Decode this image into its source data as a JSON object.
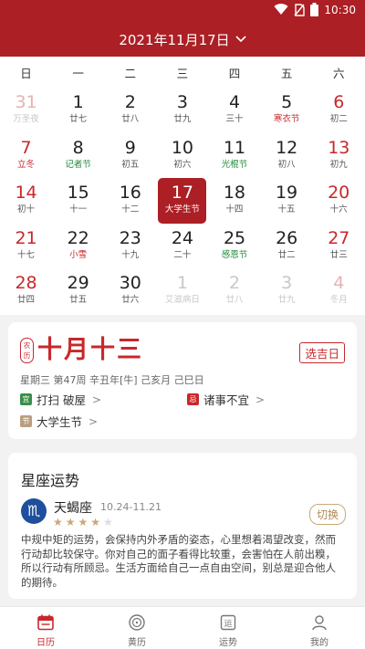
{
  "status": {
    "time": "10:30"
  },
  "header": {
    "month_title": "2021年11月17日"
  },
  "weekdays": [
    "日",
    "一",
    "二",
    "三",
    "四",
    "五",
    "六"
  ],
  "weeks": [
    [
      {
        "num": "31",
        "sub": "万圣夜"
      },
      {
        "num": "1",
        "sub": "廿七"
      },
      {
        "num": "2",
        "sub": "廿八"
      },
      {
        "num": "3",
        "sub": "廿九"
      },
      {
        "num": "4",
        "sub": "三十"
      },
      {
        "num": "5",
        "sub": "寒衣节"
      },
      {
        "num": "6",
        "sub": "初二"
      }
    ],
    [
      {
        "num": "7",
        "sub": "立冬"
      },
      {
        "num": "8",
        "sub": "记者节"
      },
      {
        "num": "9",
        "sub": "初五"
      },
      {
        "num": "10",
        "sub": "初六"
      },
      {
        "num": "11",
        "sub": "光棍节"
      },
      {
        "num": "12",
        "sub": "初八"
      },
      {
        "num": "13",
        "sub": "初九"
      }
    ],
    [
      {
        "num": "14",
        "sub": "初十"
      },
      {
        "num": "15",
        "sub": "十一"
      },
      {
        "num": "16",
        "sub": "十二"
      },
      {
        "num": "17",
        "sub": "大学生节"
      },
      {
        "num": "18",
        "sub": "十四"
      },
      {
        "num": "19",
        "sub": "十五"
      },
      {
        "num": "20",
        "sub": "十六"
      }
    ],
    [
      {
        "num": "21",
        "sub": "十七"
      },
      {
        "num": "22",
        "sub": "小雪"
      },
      {
        "num": "23",
        "sub": "十九"
      },
      {
        "num": "24",
        "sub": "二十"
      },
      {
        "num": "25",
        "sub": "感恩节"
      },
      {
        "num": "26",
        "sub": "廿二"
      },
      {
        "num": "27",
        "sub": "廿三"
      }
    ],
    [
      {
        "num": "28",
        "sub": "廿四"
      },
      {
        "num": "29",
        "sub": "廿五"
      },
      {
        "num": "30",
        "sub": "廿六"
      },
      {
        "num": "1",
        "sub": "艾滋病日"
      },
      {
        "num": "2",
        "sub": "廿八"
      },
      {
        "num": "3",
        "sub": "廿九"
      },
      {
        "num": "4",
        "sub": "冬月"
      }
    ]
  ],
  "almanac": {
    "seal": "农历",
    "lunar_date": "十月十三",
    "pick_day": "选吉日",
    "ganzhi": "星期三 第47周 辛丑年[牛] 己亥月 己巳日",
    "yi_tag": "宜",
    "yi_text": "打扫 破屋",
    "ji_tag": "忌",
    "ji_text": "诸事不宜",
    "fest_tag": "节",
    "fest_text": "大学生节"
  },
  "horoscope": {
    "title": "星座运势",
    "sign": "天蝎座",
    "range": "10.24-11.21",
    "rating": 4,
    "switch": "切换",
    "text": "中规中矩的运势，会保持内外矛盾的姿态，心里想着渴望改变，然而行动却比较保守。你对自己的面子看得比较重，会害怕在人前出糗，所以行动有所顾忌。生活方面给自己一点自由空间，别总是迎合他人的期待。"
  },
  "tabs": [
    {
      "label": "日历",
      "active": true
    },
    {
      "label": "黄历"
    },
    {
      "label": "运势"
    },
    {
      "label": "我的"
    }
  ],
  "colors": {
    "primary": "#ac1f24",
    "festival_red": "#c8282b",
    "festival_green": "#21893a",
    "gold": "#c9a87a"
  }
}
